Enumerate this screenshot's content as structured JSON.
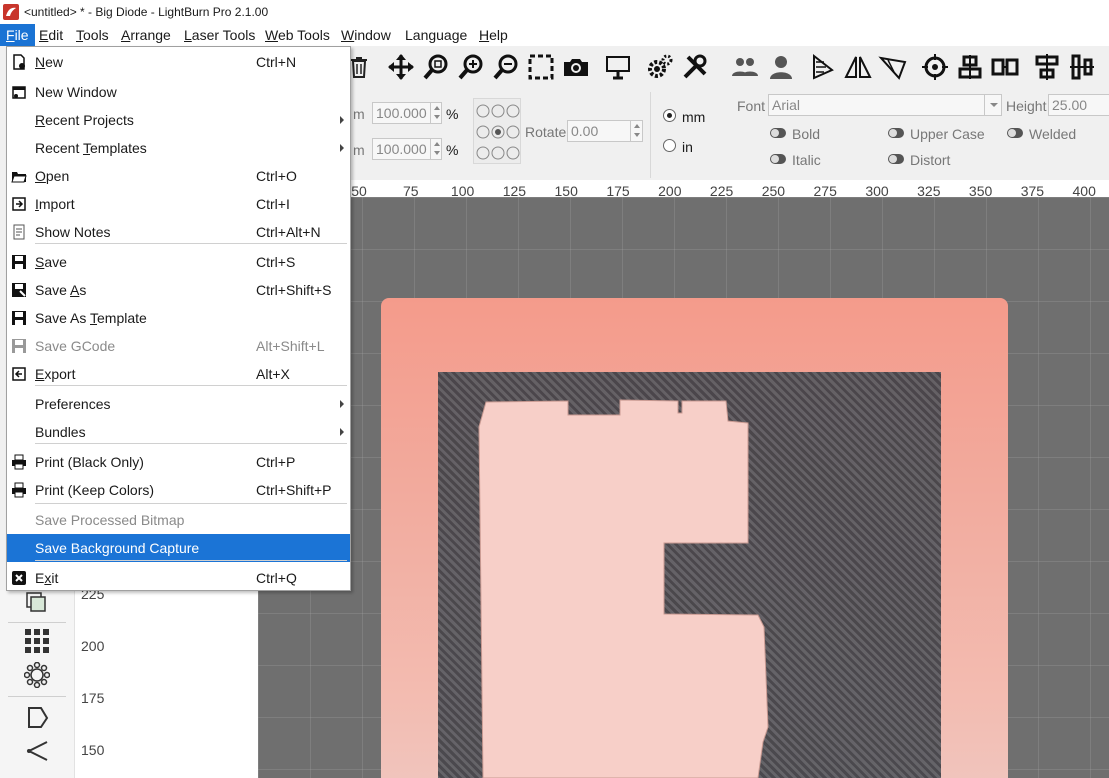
{
  "window": {
    "title": "<untitled> * - Big Diode - LightBurn Pro 2.1.00"
  },
  "menubar": [
    {
      "key": "file",
      "pre": "",
      "mn": "F",
      "post": "ile",
      "active": true
    },
    {
      "key": "edit",
      "pre": "",
      "mn": "E",
      "post": "dit"
    },
    {
      "key": "tools",
      "pre": "",
      "mn": "T",
      "post": "ools"
    },
    {
      "key": "arrange",
      "pre": "",
      "mn": "A",
      "post": "rrange"
    },
    {
      "key": "laser_tools",
      "pre": "",
      "mn": "L",
      "post": "aser Tools"
    },
    {
      "key": "web_tools",
      "pre": "",
      "mn": "W",
      "post": "eb Tools"
    },
    {
      "key": "window",
      "pre": "",
      "mn": "W",
      "post": "indow"
    },
    {
      "key": "language",
      "pre": "Language",
      "mn": "",
      "post": ""
    },
    {
      "key": "help",
      "pre": "",
      "mn": "H",
      "post": "elp"
    }
  ],
  "toolbar_icons": [
    "trash-icon",
    "move-icon",
    "zoom-fit-icon",
    "zoom-in-icon",
    "zoom-out-icon",
    "select-frame-icon",
    "camera-icon",
    "monitor-icon",
    "gear-icon",
    "wrench-icon",
    "users-icon",
    "user-icon",
    "mirror-h-icon",
    "mirror-v-icon",
    "path-icon",
    "target-icon",
    "align-icon",
    "group-icon",
    "distribute-h-icon",
    "distribute-v-icon"
  ],
  "props": {
    "width_value": "100.000",
    "height_value": "100.000",
    "unit_prefix": "m",
    "percent": "%",
    "rotate_label": "Rotate",
    "rotate_value": "0.00",
    "unit_mm": "mm",
    "unit_in": "in",
    "font_label": "Font",
    "font_value": "Arial",
    "height_label": "Height",
    "height_font_value": "25.00",
    "bold": "Bold",
    "italic": "Italic",
    "upper_case": "Upper Case",
    "distort": "Distort",
    "welded": "Welded"
  },
  "hruler_ticks": [
    "50",
    "75",
    "100",
    "125",
    "150",
    "175",
    "200",
    "225",
    "250",
    "275",
    "300",
    "325",
    "350",
    "375",
    "400"
  ],
  "vruler_ticks": [
    "225",
    "200",
    "175",
    "150"
  ],
  "file_menu": [
    {
      "label_pre": "",
      "mn": "N",
      "label_post": "ew",
      "shortcut": "Ctrl+N",
      "icon": "new-file-icon"
    },
    {
      "label_pre": "New Window",
      "mn": "",
      "label_post": "",
      "shortcut": "",
      "icon": "new-window-icon"
    },
    {
      "label_pre": "",
      "mn": "R",
      "label_post": "ecent Projects",
      "shortcut": "",
      "submenu": true
    },
    {
      "label_pre": "Recent ",
      "mn": "T",
      "label_post": "emplates",
      "shortcut": "",
      "submenu": true
    },
    {
      "label_pre": "",
      "mn": "O",
      "label_post": "pen",
      "shortcut": "Ctrl+O",
      "icon": "open-folder-icon"
    },
    {
      "label_pre": "",
      "mn": "I",
      "label_post": "mport",
      "shortcut": "Ctrl+I",
      "icon": "import-icon"
    },
    {
      "label_pre": "Show Notes",
      "mn": "",
      "label_post": "",
      "shortcut": "Ctrl+Alt+N",
      "icon": "notes-icon"
    },
    {
      "label_pre": "",
      "mn": "S",
      "label_post": "ave",
      "shortcut": "Ctrl+S",
      "icon": "save-icon"
    },
    {
      "label_pre": "Save ",
      "mn": "A",
      "label_post": "s",
      "shortcut": "Ctrl+Shift+S",
      "icon": "save-as-icon"
    },
    {
      "label_pre": "Save As ",
      "mn": "T",
      "label_post": "emplate",
      "shortcut": "",
      "icon": "save-template-icon"
    },
    {
      "label_pre": "Save GCode",
      "mn": "",
      "label_post": "",
      "shortcut": "Alt+Shift+L",
      "icon": "save-gcode-icon",
      "disabled": true
    },
    {
      "label_pre": "",
      "mn": "E",
      "label_post": "xport",
      "shortcut": "Alt+X",
      "icon": "export-icon"
    },
    {
      "label_pre": "Preferences",
      "mn": "",
      "label_post": "",
      "shortcut": "",
      "submenu": true
    },
    {
      "label_pre": "Bundles",
      "mn": "",
      "label_post": "",
      "shortcut": "",
      "submenu": true
    },
    {
      "label_pre": "Print (Black Only)",
      "mn": "",
      "label_post": "",
      "shortcut": "Ctrl+P",
      "icon": "print-icon"
    },
    {
      "label_pre": "Print (Keep Colors)",
      "mn": "",
      "label_post": "",
      "shortcut": "Ctrl+Shift+P",
      "icon": "print-color-icon"
    },
    {
      "label_pre": "Save Processed Bitmap",
      "mn": "",
      "label_post": "",
      "shortcut": "",
      "disabled": true
    },
    {
      "label_pre": "Save Background Capture",
      "mn": "",
      "label_post": "",
      "shortcut": "",
      "highlighted": true
    },
    {
      "label_pre": "E",
      "mn": "x",
      "label_post": "it",
      "shortcut": "Ctrl+Q",
      "icon": "exit-icon"
    }
  ],
  "colors": {
    "menu_highlight": "#1b74d6",
    "active_menu": "#1a73d4",
    "app_icon": "#c8352c"
  }
}
